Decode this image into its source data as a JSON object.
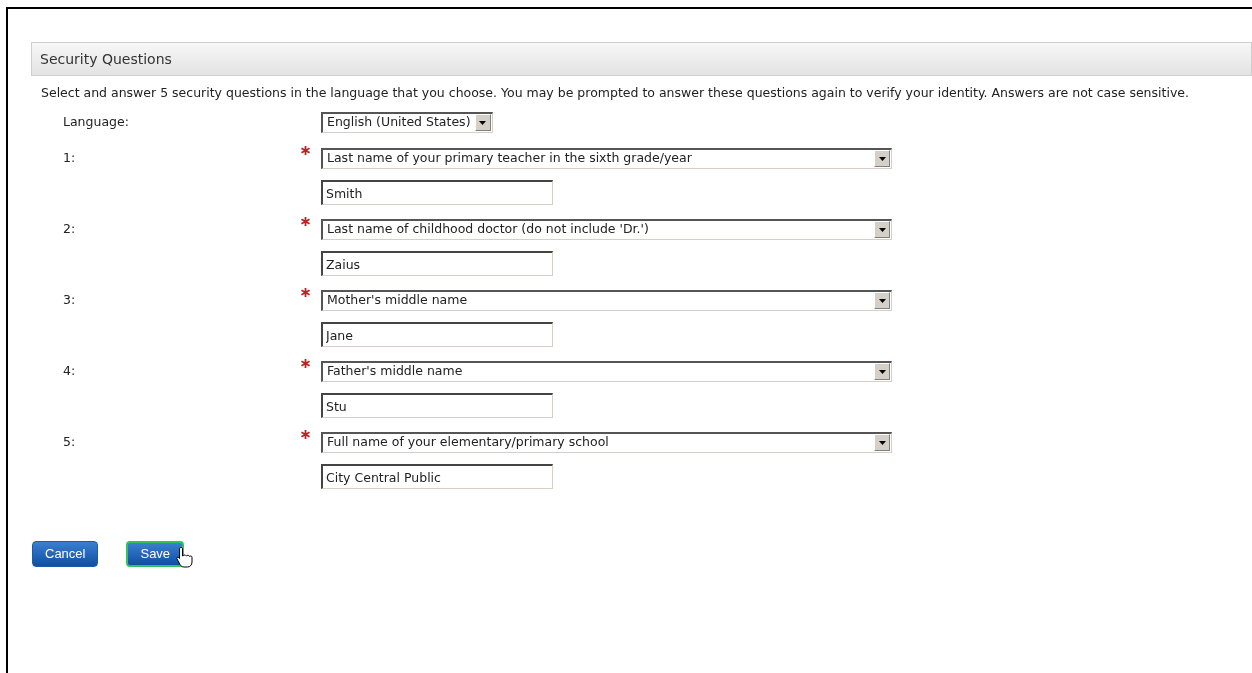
{
  "section": {
    "title": "Security Questions"
  },
  "instructions": "Select and answer 5 security questions in the language that you choose. You may be prompted to answer these questions again to verify your identity. Answers are not case sensitive.",
  "language": {
    "label": "Language:",
    "value": "English (United States)"
  },
  "questions": [
    {
      "label": "1:",
      "required": true,
      "question": "Last name of your primary teacher in the sixth grade/year",
      "answer": "Smith"
    },
    {
      "label": "2:",
      "required": true,
      "question": "Last name of childhood doctor (do not include 'Dr.')",
      "answer": "Zaius"
    },
    {
      "label": "3:",
      "required": true,
      "question": "Mother's middle name",
      "answer": "Jane"
    },
    {
      "label": "4:",
      "required": true,
      "question": "Father's middle name",
      "answer": "Stu"
    },
    {
      "label": "5:",
      "required": true,
      "question": "Full name of your elementary/primary school",
      "answer": "City Central Public"
    }
  ],
  "buttons": [
    {
      "label": "Cancel",
      "focused": false
    },
    {
      "label": "Save",
      "focused": true
    }
  ]
}
